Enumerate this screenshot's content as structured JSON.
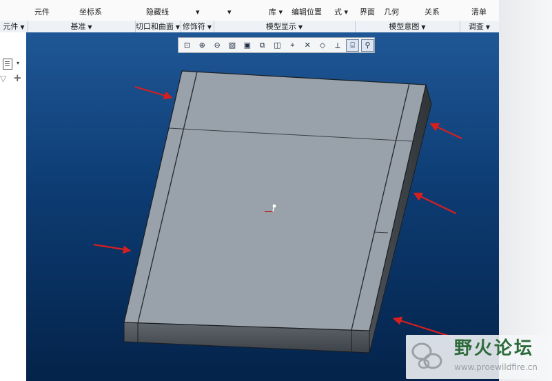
{
  "ribbon": {
    "top_items": [
      "元件",
      "坐标系",
      "隐藏线",
      "▾",
      "▾",
      "库 ▾",
      "编辑位置",
      "式 ▾",
      "界面",
      "几何",
      "关系",
      "清单"
    ],
    "groups": [
      {
        "label": "元件"
      },
      {
        "label": "基准"
      },
      {
        "label": "切口和曲面"
      },
      {
        "label": "修饰符"
      },
      {
        "label": "模型显示"
      },
      {
        "label": "模型意图"
      },
      {
        "label": "调查"
      }
    ]
  },
  "view_toolbar": {
    "buttons": [
      {
        "name": "refit-icon",
        "glyph": "⊡",
        "active": false
      },
      {
        "name": "zoom-in-icon",
        "glyph": "⊕",
        "active": false
      },
      {
        "name": "zoom-out-icon",
        "glyph": "⊖",
        "active": false
      },
      {
        "name": "repaint-icon",
        "glyph": "▧",
        "active": false
      },
      {
        "name": "display-style-icon",
        "glyph": "▣",
        "active": false
      },
      {
        "name": "saved-orientations-icon",
        "glyph": "⧉",
        "active": false
      },
      {
        "name": "view-manager-icon",
        "glyph": "◫",
        "active": false
      },
      {
        "name": "datum-display-icon",
        "glyph": "⌖",
        "active": false
      },
      {
        "name": "datum-axis-icon",
        "glyph": "✕",
        "active": false
      },
      {
        "name": "datum-plane-icon",
        "glyph": "◇",
        "active": false
      },
      {
        "name": "csys-display-icon",
        "glyph": "⟂",
        "active": false
      },
      {
        "name": "annotation-display-icon",
        "glyph": "⌸",
        "active": true
      },
      {
        "name": "spin-center-icon",
        "glyph": "⚲",
        "active": true
      }
    ]
  },
  "left_panel": {
    "tree_caret": "▾",
    "filter_glyph": "▽",
    "add_glyph": "+"
  },
  "watermark": {
    "title": "野火论坛",
    "url": "www.proewildfire.cn"
  },
  "colors": {
    "viewport_top": "#1f5796",
    "viewport_bottom": "#04234a",
    "model_face": "#99a2aa",
    "arrow_red": "#d61f1f"
  }
}
